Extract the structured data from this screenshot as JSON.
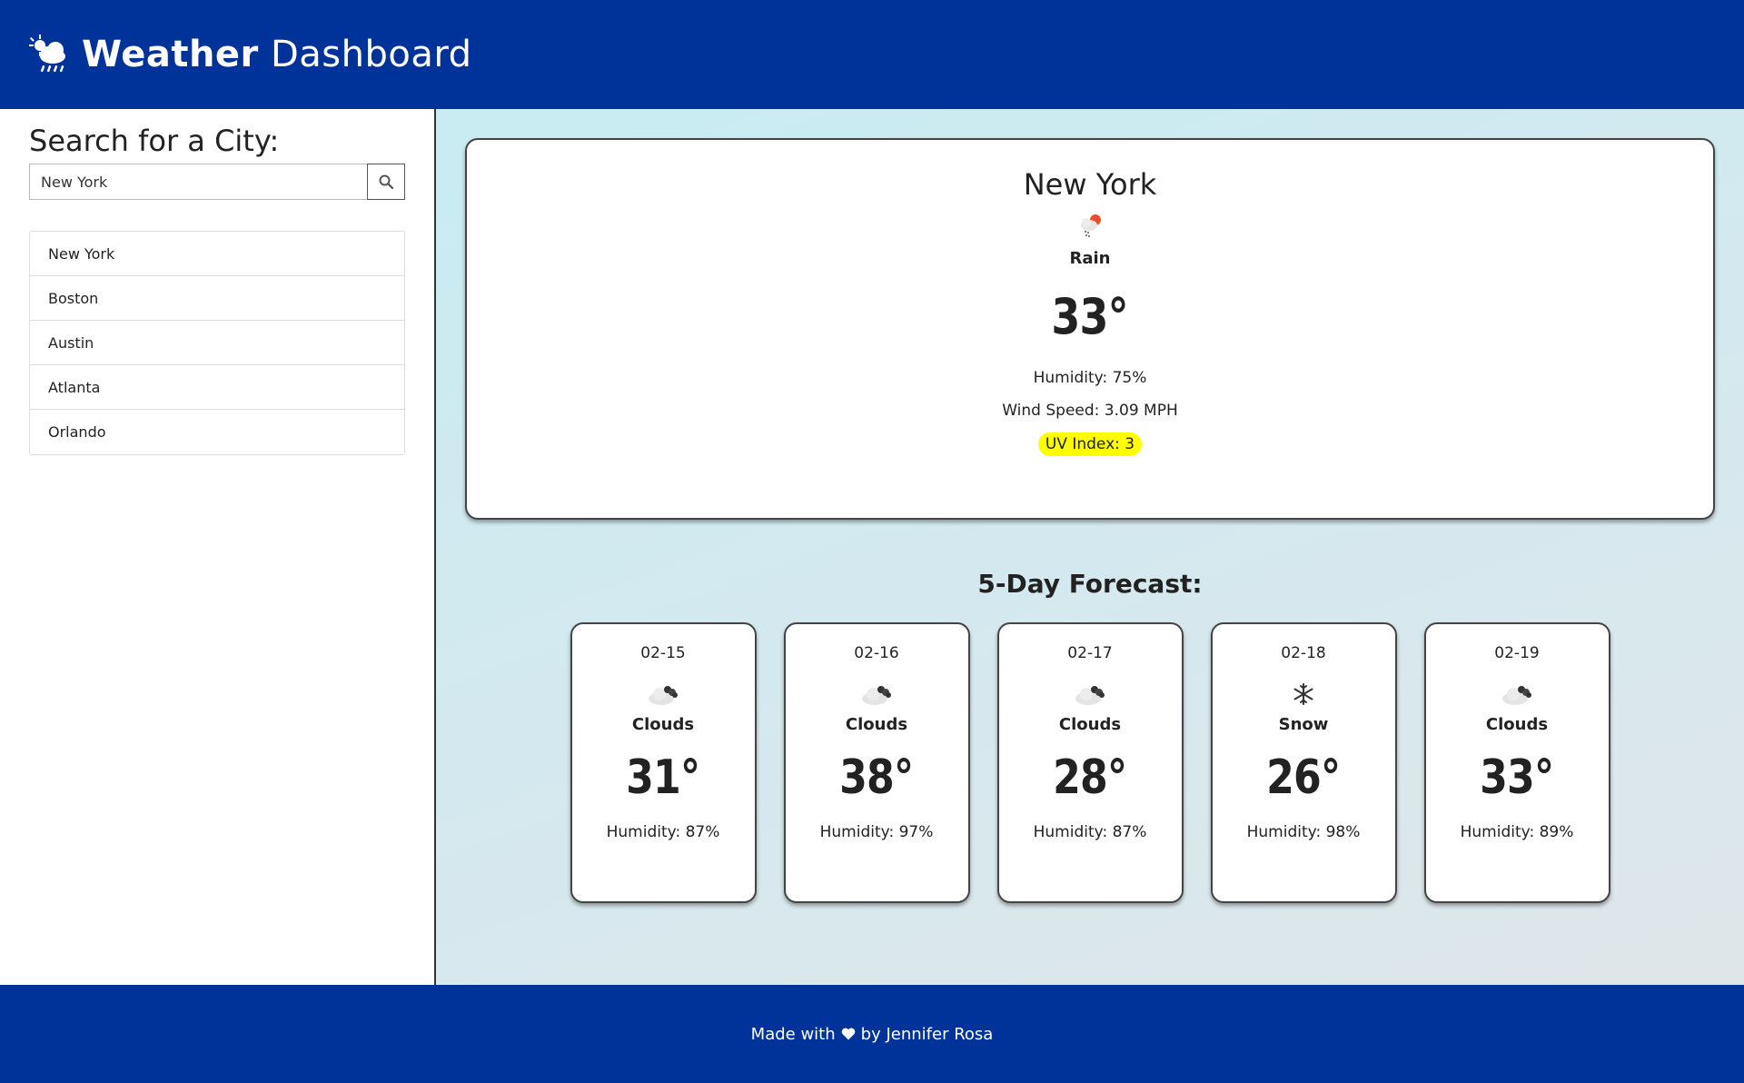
{
  "header": {
    "title_bold": "Weather",
    "title_rest": " Dashboard",
    "icon": "cloud-sun-rain-icon"
  },
  "sidebar": {
    "heading": "Search for a City:",
    "search_value": "New York",
    "search_icon": "search-icon",
    "cities": [
      "New York",
      "Boston",
      "Austin",
      "Atlanta",
      "Orlando"
    ]
  },
  "current": {
    "city": "New York",
    "condition": "Rain",
    "icon": "rain-icon",
    "temp": "33°",
    "humidity": "Humidity: 75%",
    "wind": "Wind Speed: 3.09 MPH",
    "uv": "UV Index: 3",
    "uv_color": "#ffff00"
  },
  "forecast": {
    "title": "5-Day Forecast:",
    "days": [
      {
        "date": "02-15",
        "condition": "Clouds",
        "icon": "clouds-icon",
        "temp": "31°",
        "humidity": "Humidity: 87%"
      },
      {
        "date": "02-16",
        "condition": "Clouds",
        "icon": "clouds-icon",
        "temp": "38°",
        "humidity": "Humidity: 97%"
      },
      {
        "date": "02-17",
        "condition": "Clouds",
        "icon": "clouds-icon",
        "temp": "28°",
        "humidity": "Humidity: 87%"
      },
      {
        "date": "02-18",
        "condition": "Snow",
        "icon": "snowflake-icon",
        "temp": "26°",
        "humidity": "Humidity: 98%"
      },
      {
        "date": "02-19",
        "condition": "Clouds",
        "icon": "clouds-icon",
        "temp": "33°",
        "humidity": "Humidity: 89%"
      }
    ]
  },
  "footer": {
    "before": "Made with",
    "after": "by Jennifer Rosa"
  },
  "colors": {
    "brand": "#003399",
    "uv_badge": "#ffff00"
  }
}
